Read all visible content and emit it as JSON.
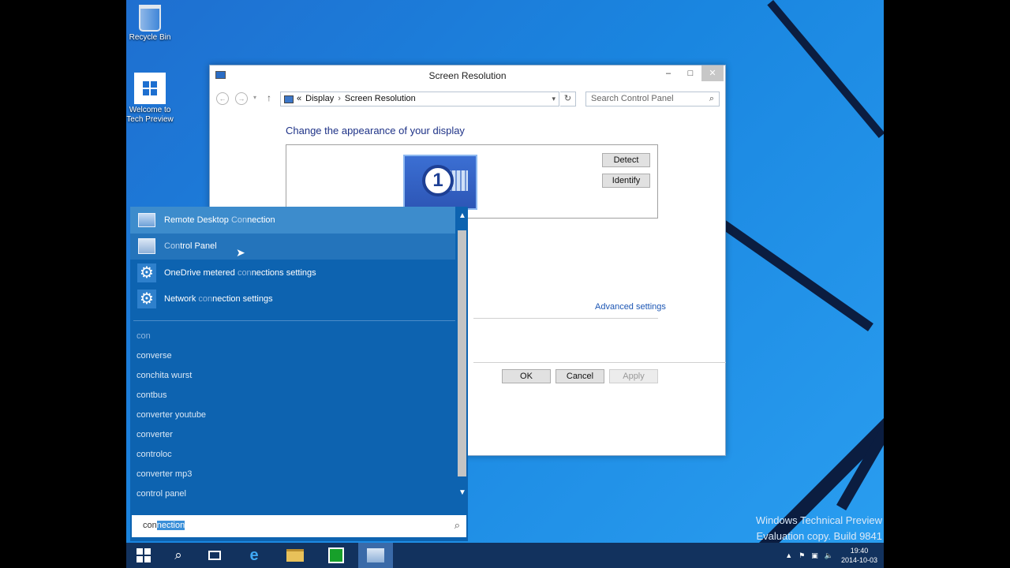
{
  "desktop": {
    "icons": [
      {
        "label": "Recycle Bin"
      },
      {
        "label": "Welcome to Tech Preview"
      }
    ],
    "watermark": {
      "line1": "Windows Technical Preview",
      "line2": "Evaluation copy. Build 9841"
    }
  },
  "window": {
    "title": "Screen Resolution",
    "minimize": "–",
    "maximize": "□",
    "close": "✕",
    "address": {
      "root_chevron": "«",
      "crumb1": "Display",
      "crumb2": "Screen Resolution"
    },
    "search_placeholder": "Search Control Panel",
    "heading": "Change the appearance of your display",
    "monitor_number": "1",
    "detect": "Detect",
    "identify": "Identify",
    "advanced": "Advanced settings",
    "ok": "OK",
    "cancel": "Cancel",
    "apply": "Apply"
  },
  "search": {
    "apps": [
      {
        "pre": "Remote Desktop ",
        "hl": "Con",
        "post": "nection"
      },
      {
        "pre": "",
        "hl": "Con",
        "post": "trol Panel"
      },
      {
        "pre": "OneDrive metered ",
        "hl": "con",
        "post": "nections settings"
      },
      {
        "pre": "Network ",
        "hl": "con",
        "post": "nection settings"
      }
    ],
    "suggestions": [
      "con",
      "converse",
      "conchita wurst",
      "contbus",
      "converter youtube",
      "converter",
      "controloc",
      "converter mp3",
      "control panel"
    ],
    "query_typed": "con",
    "query_selected": "nection"
  },
  "taskbar": {
    "time": "19:40",
    "date": "2014-10-03"
  },
  "colors": {
    "search_bg": "#0d63b0",
    "selected_item": "#3d8ccc",
    "taskbar": "#12325e",
    "heading": "#1e3287"
  }
}
